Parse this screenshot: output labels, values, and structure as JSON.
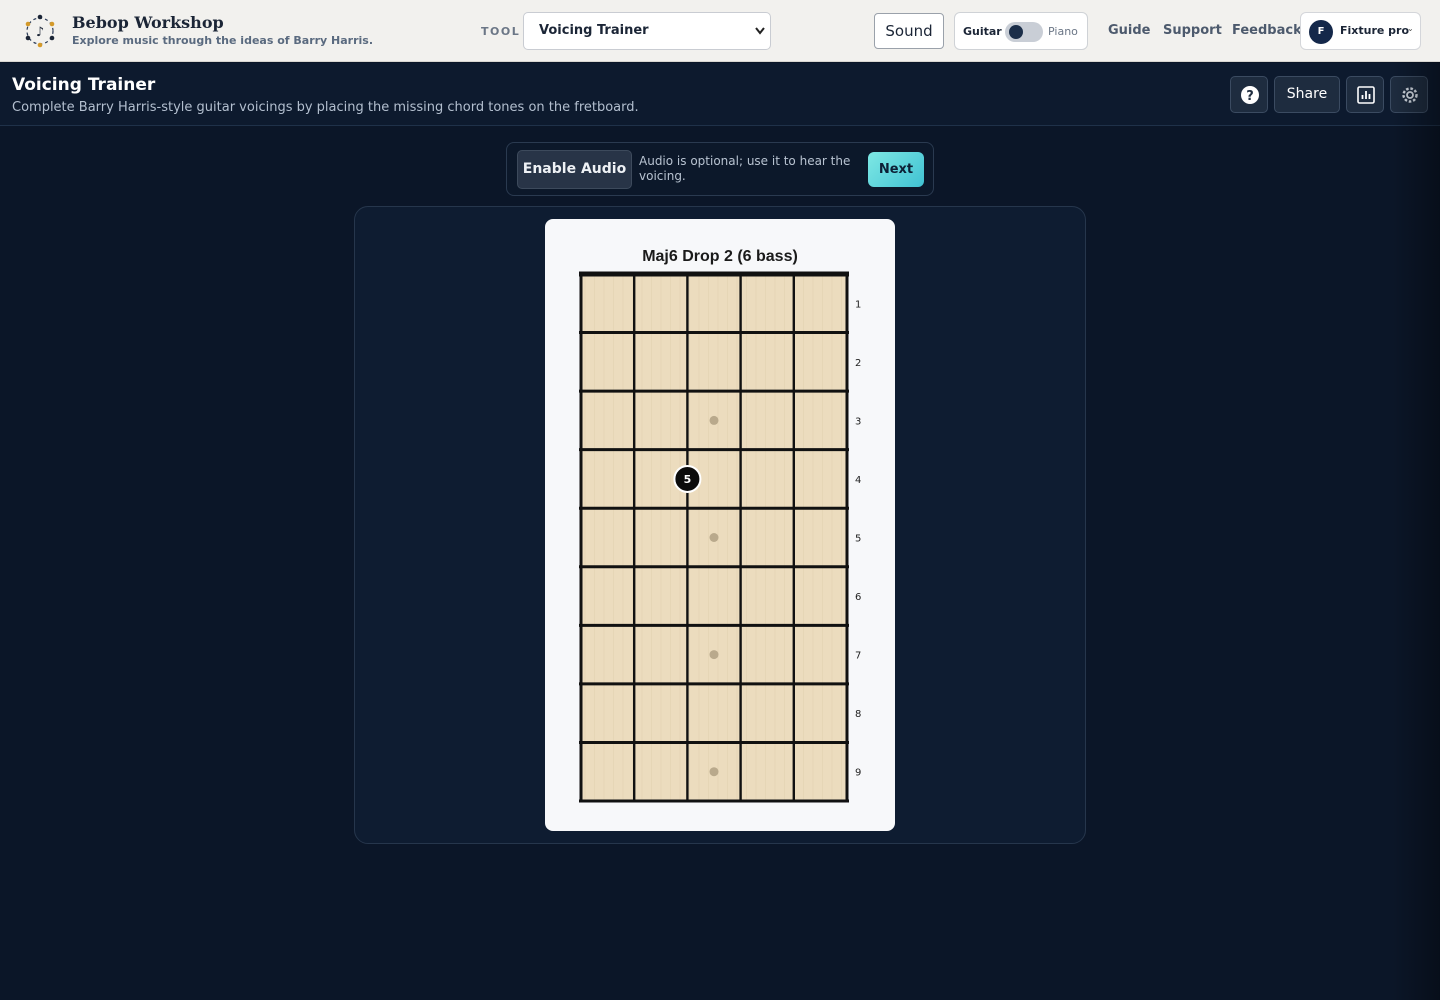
{
  "app": {
    "name": "Bebop Workshop",
    "tagline": "Explore music through the ideas of Barry Harris."
  },
  "toolbar": {
    "tool_label": "TOOL",
    "tool_selected": "Voicing Trainer",
    "sound_label": "Sound",
    "mode_left": "Guitar",
    "mode_right": "Piano",
    "mode_active": "Guitar",
    "nav": [
      "Guide",
      "Support",
      "Feedback"
    ],
    "user_initial": "F",
    "user_name": "Fixture pro"
  },
  "page": {
    "title": "Voicing Trainer",
    "subtitle": "Complete Barry Harris-style guitar voicings by placing the missing chord tones on the fretboard.",
    "share_label": "Share"
  },
  "audio": {
    "enable_label": "Enable Audio",
    "note": "Audio is optional; use it to hear the voicing.",
    "next_label": "Next"
  },
  "fretboard": {
    "chord_name": "Maj6 Drop 2 (6 bass)",
    "fret_numbers": [
      "1",
      "2",
      "3",
      "4",
      "5",
      "6",
      "7",
      "8",
      "9"
    ],
    "inlay_frets": [
      3,
      5,
      7,
      9
    ],
    "placed_notes": [
      {
        "string": 3,
        "fret": 4,
        "label": "5"
      }
    ]
  },
  "colors": {
    "accent_next": "#40c2d3",
    "page_bg": "#0b1628",
    "fretboard_wood": "#ecdcbe"
  }
}
